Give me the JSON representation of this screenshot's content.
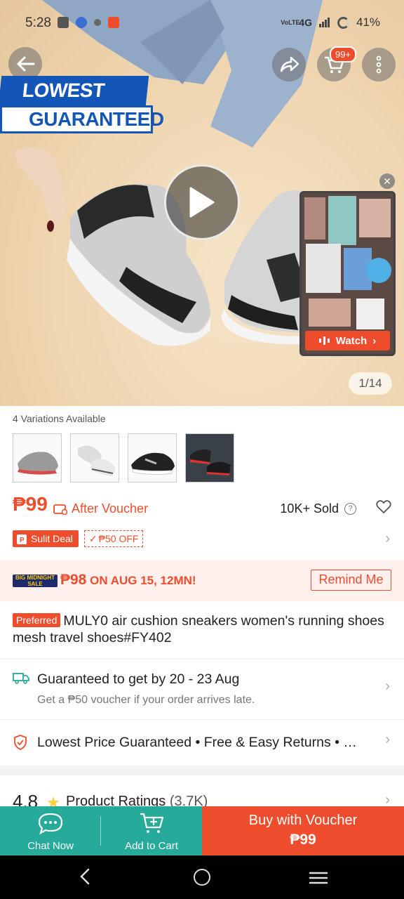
{
  "status_bar": {
    "time": "5:28",
    "network": "4G",
    "network_prefix": "VoLTE",
    "battery": "41%"
  },
  "top_nav": {
    "cart_badge": "99+"
  },
  "promo_banner": {
    "line1": "LOWEST PRICE",
    "line2": "GUARANTEED"
  },
  "media": {
    "watch_label": "Watch",
    "counter": "1/14"
  },
  "variations": {
    "label": "4 Variations Available",
    "count": 4
  },
  "price": {
    "value": "₱99",
    "after_voucher": "After Voucher",
    "sold": "10K+ Sold",
    "help": "?"
  },
  "deal": {
    "sulit_label": "Sulit Deal",
    "voucher_tag": "₱50 OFF"
  },
  "midnight_sale": {
    "badge": "BIG MIDNIGHT SALE",
    "price": "₱98",
    "text": "ON AUG 15, 12MN!",
    "remind_label": "Remind Me"
  },
  "product": {
    "preferred_badge": "Preferred",
    "title": "MULY0 air cushion sneakers women's running shoes mesh travel shoes#FY402"
  },
  "shipping": {
    "title": "Guaranteed to get by 20 - 23 Aug",
    "subtitle": "Get a ₱50 voucher if your order arrives late."
  },
  "guarantees": {
    "text": "Lowest Price Guaranteed  •  Free & Easy Returns  •  …"
  },
  "ratings": {
    "score": "4.8",
    "label": "Product Ratings",
    "count": "(3.7K)"
  },
  "actions": {
    "chat_label": "Chat Now",
    "cart_label": "Add to Cart",
    "buy_label": "Buy with Voucher",
    "buy_price": "₱99"
  },
  "colors": {
    "brand_orange": "#ee4d2d",
    "teal": "#26aa99",
    "banner_blue": "#1456b8"
  }
}
